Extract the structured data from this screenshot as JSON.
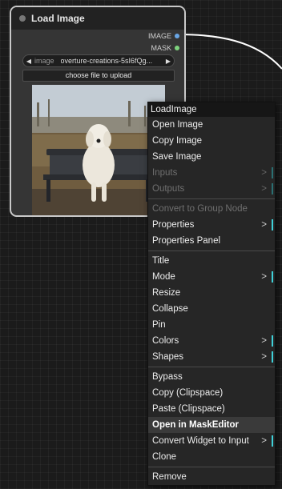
{
  "node": {
    "title": "Load Image",
    "outputs": [
      {
        "label": "IMAGE",
        "color": "#6aa7e6"
      },
      {
        "label": "MASK",
        "color": "#7ed37e"
      }
    ],
    "image_widget": {
      "name": "image",
      "value": "overture-creations-5sI6fQg...",
      "left_arrow": "◀",
      "right_arrow": "▶"
    },
    "upload_button": "choose file to upload"
  },
  "context_menu": {
    "title": "LoadImage",
    "group1": [
      {
        "label": "Open Image"
      },
      {
        "label": "Copy Image"
      },
      {
        "label": "Save Image"
      },
      {
        "label": "Inputs",
        "submenu": ">"
      },
      {
        "label": "Outputs",
        "submenu": ">"
      }
    ],
    "group2": [
      {
        "label": "Convert to Group Node"
      },
      {
        "label": "Properties",
        "submenu": ">"
      },
      {
        "label": "Properties Panel"
      }
    ],
    "group3": [
      {
        "label": "Title"
      },
      {
        "label": "Mode",
        "submenu": ">"
      },
      {
        "label": "Resize"
      },
      {
        "label": "Collapse"
      },
      {
        "label": "Pin"
      },
      {
        "label": "Colors",
        "submenu": ">"
      },
      {
        "label": "Shapes",
        "submenu": ">"
      }
    ],
    "group4": [
      {
        "label": "Bypass"
      },
      {
        "label": "Copy (Clipspace)"
      },
      {
        "label": "Paste (Clipspace)"
      },
      {
        "label": "Open in MaskEditor"
      },
      {
        "label": "Convert Widget to Input",
        "submenu": ">"
      },
      {
        "label": "Clone"
      }
    ],
    "group5": [
      {
        "label": "Remove"
      }
    ]
  }
}
